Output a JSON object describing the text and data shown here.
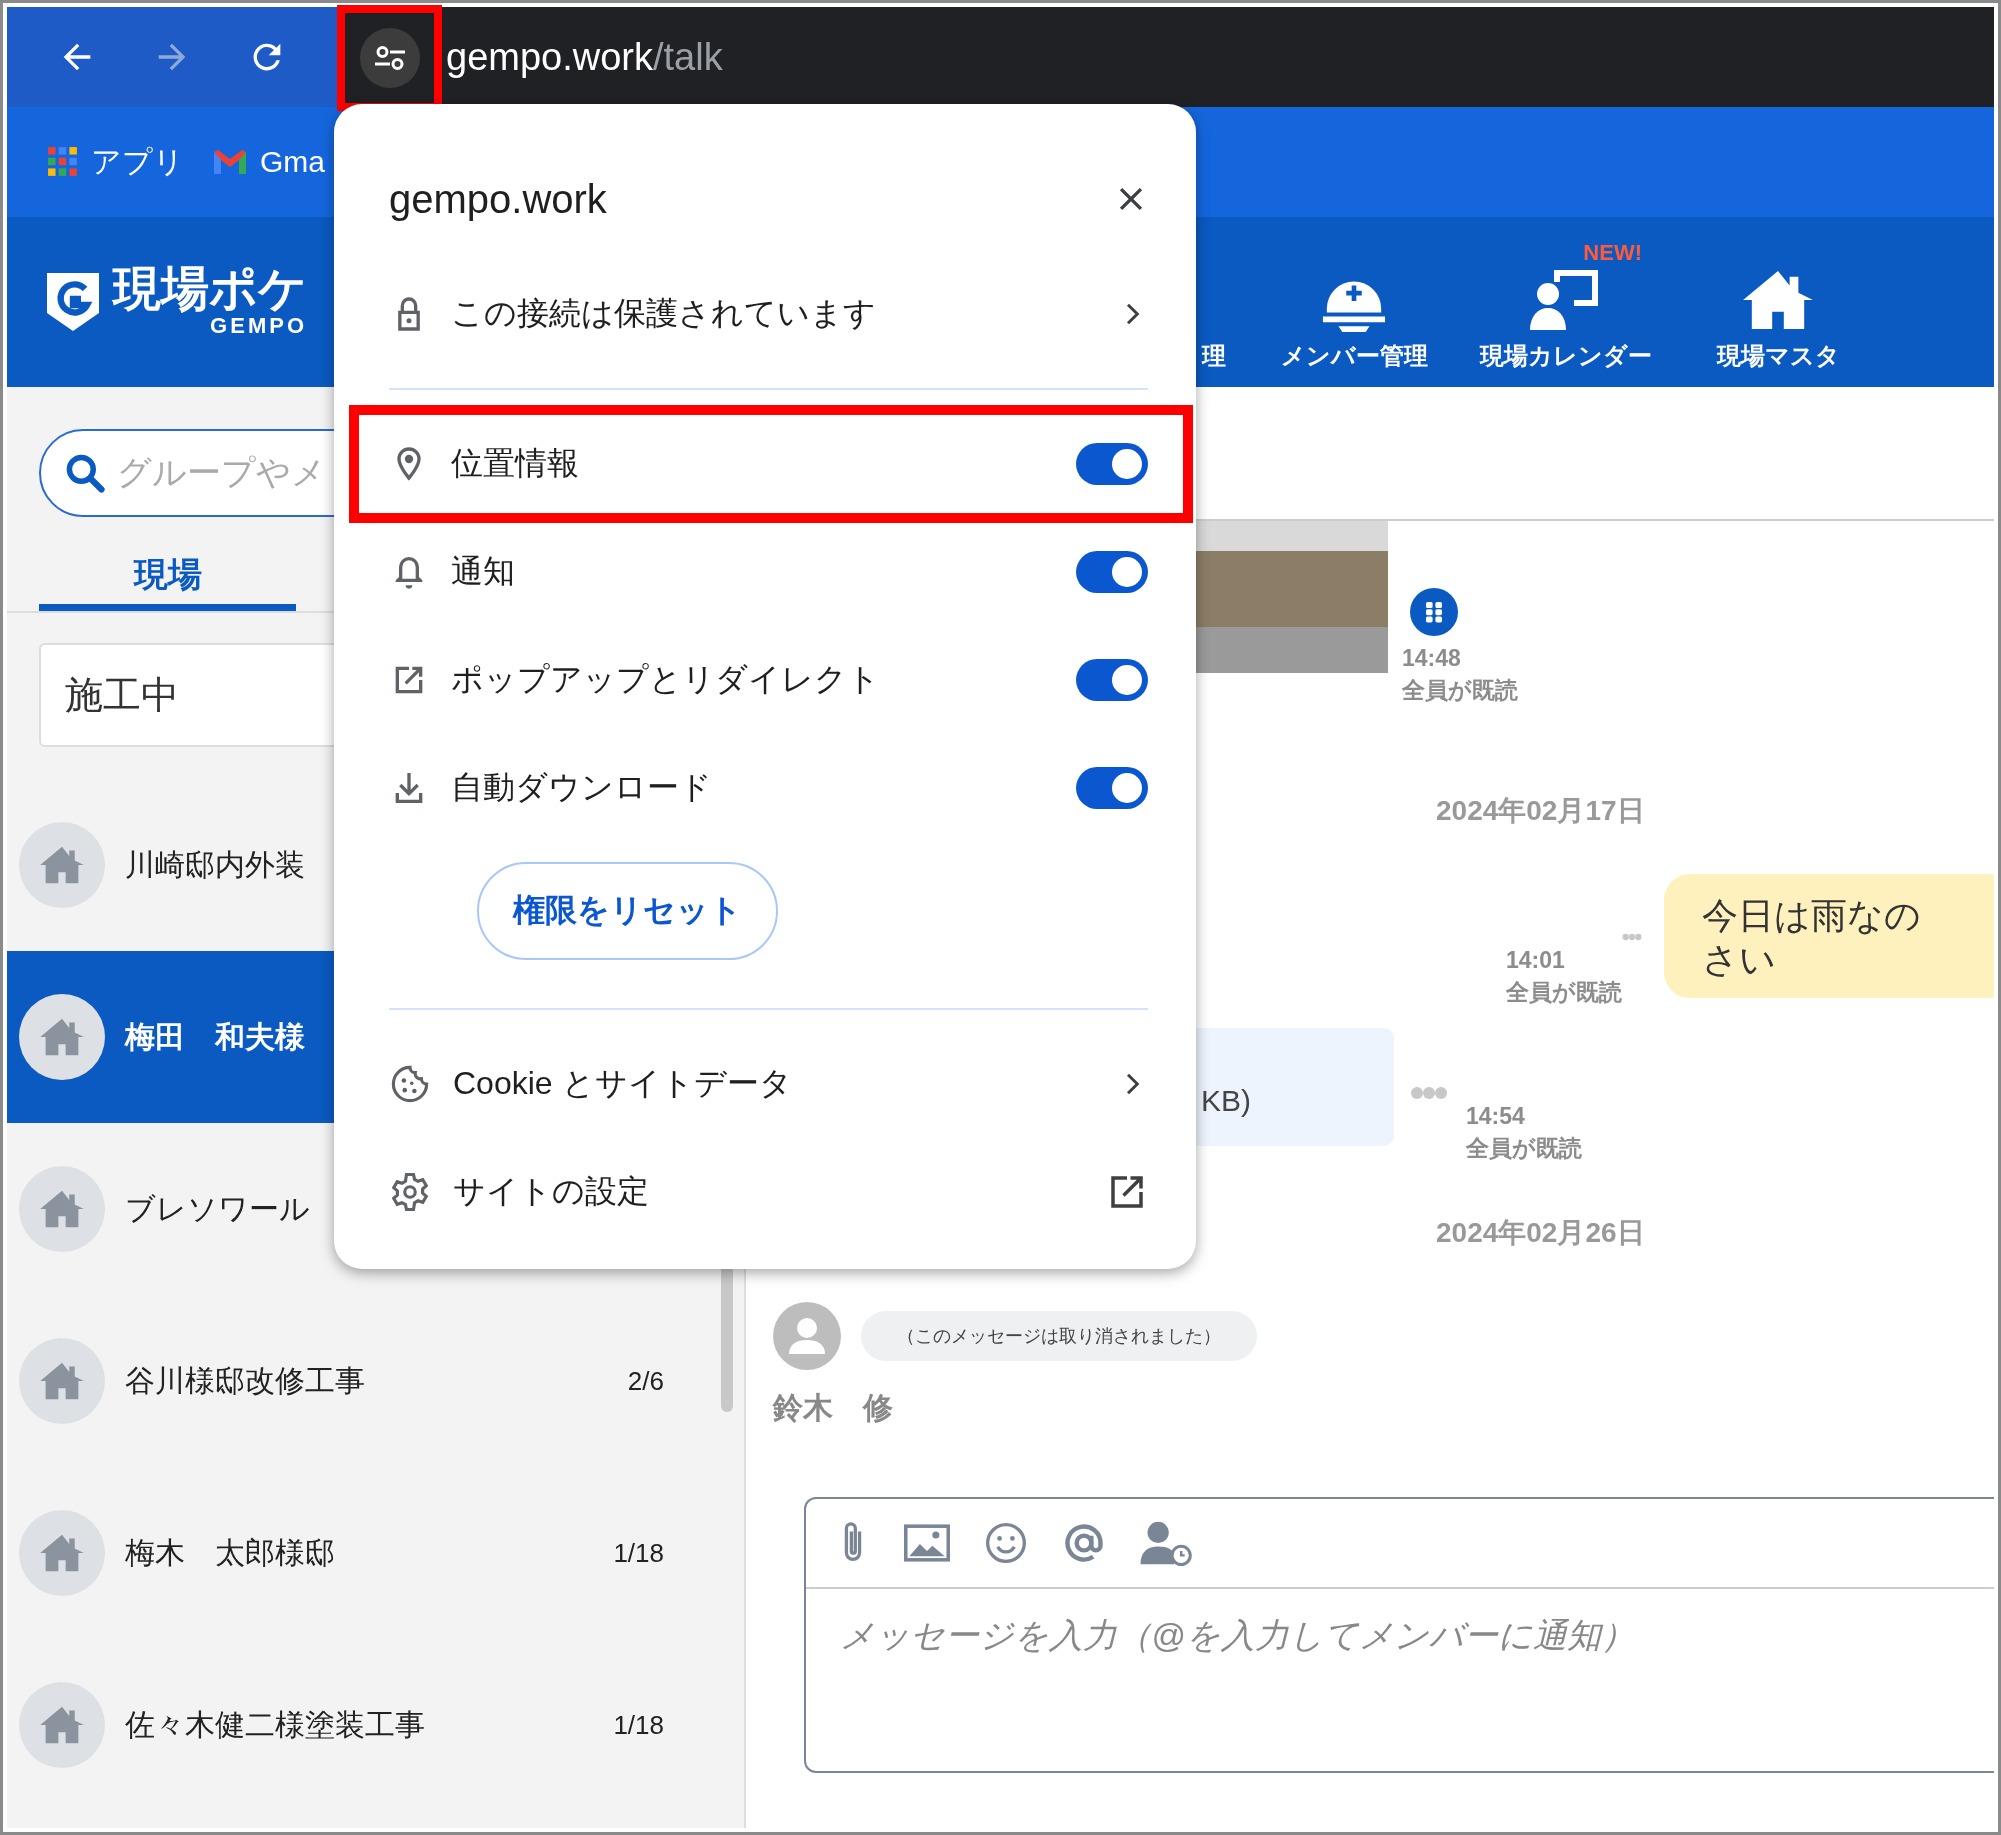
{
  "browser": {
    "site_info_highlighted": true,
    "url_host": "gempo.work",
    "url_path": "/talk",
    "bookmarks": [
      {
        "kind": "apps",
        "label": "アプリ"
      },
      {
        "kind": "mail",
        "label": "Gma"
      }
    ]
  },
  "app_header": {
    "logo_text": "現場ポケ",
    "logo_sub": "GEMPO",
    "nav": [
      {
        "kind": "partial",
        "label": "理"
      },
      {
        "kind": "helmet",
        "label": "メンバー管理"
      },
      {
        "kind": "calendar",
        "label": "現場カレンダー",
        "badge": "NEW!"
      },
      {
        "kind": "house",
        "label": "現場マスタ"
      }
    ]
  },
  "sidebar": {
    "search_placeholder": "グループやメ",
    "tabs": [
      {
        "label": "現場",
        "selected": true
      }
    ],
    "filter": "施工中",
    "items": [
      {
        "name": "川崎邸内外装",
        "selected": false
      },
      {
        "name": "梅田　和夫様",
        "selected": true
      },
      {
        "name": "ブレソワール",
        "selected": false
      },
      {
        "name": "谷川様邸改修工事",
        "count": "2/6",
        "selected": false
      },
      {
        "name": "梅木　太郎様邸",
        "count": "1/18",
        "selected": false
      },
      {
        "name": "佐々木健二様塗装工事",
        "count": "1/18",
        "selected": false
      }
    ]
  },
  "chat": {
    "items": [
      {
        "kind": "photo",
        "time": "14:48",
        "read": "全員が既読"
      },
      {
        "kind": "date",
        "text": "2024年02月17日"
      },
      {
        "kind": "outgoing",
        "text": "今日は雨なのさい",
        "time": "14:01",
        "read": "全員が既読"
      },
      {
        "kind": "file",
        "text": "KB)",
        "time": "14:54",
        "read": "全員が既読"
      },
      {
        "kind": "date",
        "text": "2024年02月26日"
      },
      {
        "kind": "recalled",
        "text": "（このメッセージは取り消されました）"
      },
      {
        "kind": "sender",
        "text": "鈴木　修"
      }
    ]
  },
  "composer": {
    "tools": [
      {
        "kind": "attach"
      },
      {
        "kind": "image"
      },
      {
        "kind": "emoji"
      },
      {
        "kind": "mention"
      },
      {
        "kind": "member"
      }
    ],
    "placeholder": "メッセージを入力（@を入力してメンバーに通知）"
  },
  "popup": {
    "title": "gempo.work",
    "connection": "この接続は保護されています",
    "permissions": [
      {
        "kind": "location",
        "label": "位置情報",
        "on": true,
        "highlighted": true
      },
      {
        "kind": "notification",
        "label": "通知",
        "on": true,
        "highlighted": false
      },
      {
        "kind": "popup",
        "label": "ポップアップとリダイレクト",
        "on": true,
        "highlighted": false
      },
      {
        "kind": "download",
        "label": "自動ダウンロード",
        "on": true,
        "highlighted": false
      }
    ],
    "reset_button": "権限をリセット",
    "links": [
      {
        "kind": "cookie",
        "label": "Cookie とサイトデータ"
      },
      {
        "kind": "settings",
        "label": "サイトの設定"
      }
    ]
  }
}
